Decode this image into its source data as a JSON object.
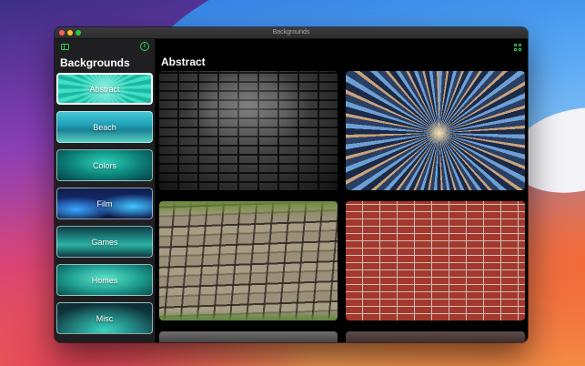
{
  "window": {
    "title": "Backgrounds"
  },
  "sidebar": {
    "title": "Backgrounds",
    "items": [
      {
        "label": "Abstract",
        "selected": true
      },
      {
        "label": "Beach"
      },
      {
        "label": "Colors"
      },
      {
        "label": "Film"
      },
      {
        "label": "Games"
      },
      {
        "label": "Homes"
      },
      {
        "label": "Misc"
      }
    ]
  },
  "content": {
    "title": "Abstract",
    "tiles": [
      {
        "name": "dark-brick-wall"
      },
      {
        "name": "zoom-burst-city"
      },
      {
        "name": "stone-wall"
      },
      {
        "name": "red-brick-wall"
      }
    ]
  },
  "colors": {
    "accent": "#34c759",
    "window_background": "#000000",
    "sidebar_background": "#1f1f21"
  },
  "icons": [
    "sidebar-toggle-icon",
    "info-icon",
    "grid-view-icon"
  ]
}
